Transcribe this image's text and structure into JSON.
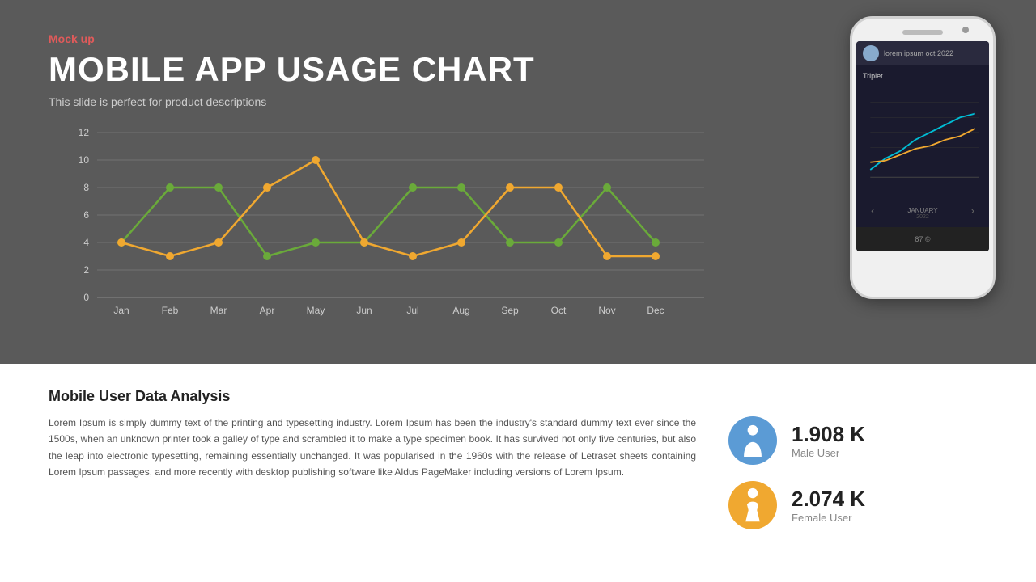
{
  "header": {
    "mock_up_label": "Mock up",
    "title": "MOBILE APP USAGE CHART",
    "subtitle": "This slide is perfect for product descriptions"
  },
  "chart": {
    "y_axis": [
      0,
      2,
      4,
      6,
      8,
      10,
      12
    ],
    "x_axis": [
      "Jan",
      "Feb",
      "Mar",
      "Apr",
      "May",
      "Jun",
      "Jul",
      "Aug",
      "Sep",
      "Oct",
      "Nov",
      "Dec"
    ],
    "series_green": [
      4,
      8,
      8,
      3,
      4,
      4,
      8,
      8,
      4,
      4,
      8,
      4
    ],
    "series_orange": [
      4,
      3,
      4,
      8,
      10,
      4,
      3,
      4,
      8,
      8,
      3,
      3
    ],
    "green_color": "#6aaa3a",
    "orange_color": "#f0a830"
  },
  "phone": {
    "month_label": "JANUARY",
    "month_sub": "2022"
  },
  "bottom": {
    "analysis_title": "Mobile User Data Analysis",
    "analysis_text": "Lorem Ipsum is simply dummy text of the printing and typesetting industry. Lorem Ipsum has been the industry's standard dummy text ever since the 1500s, when an unknown printer took a galley of type and scrambled it to make a type specimen book. It has survived not only five centuries, but also the leap into electronic typesetting, remaining essentially unchanged. It was popularised in the 1960s with the release of Letraset sheets containing Lorem Ipsum passages, and more recently with desktop publishing software like Aldus PageMaker including versions of Lorem Ipsum.",
    "male_value": "1.908 K",
    "male_label": "Male User",
    "female_value": "2.074 K",
    "female_label": "Female User"
  }
}
